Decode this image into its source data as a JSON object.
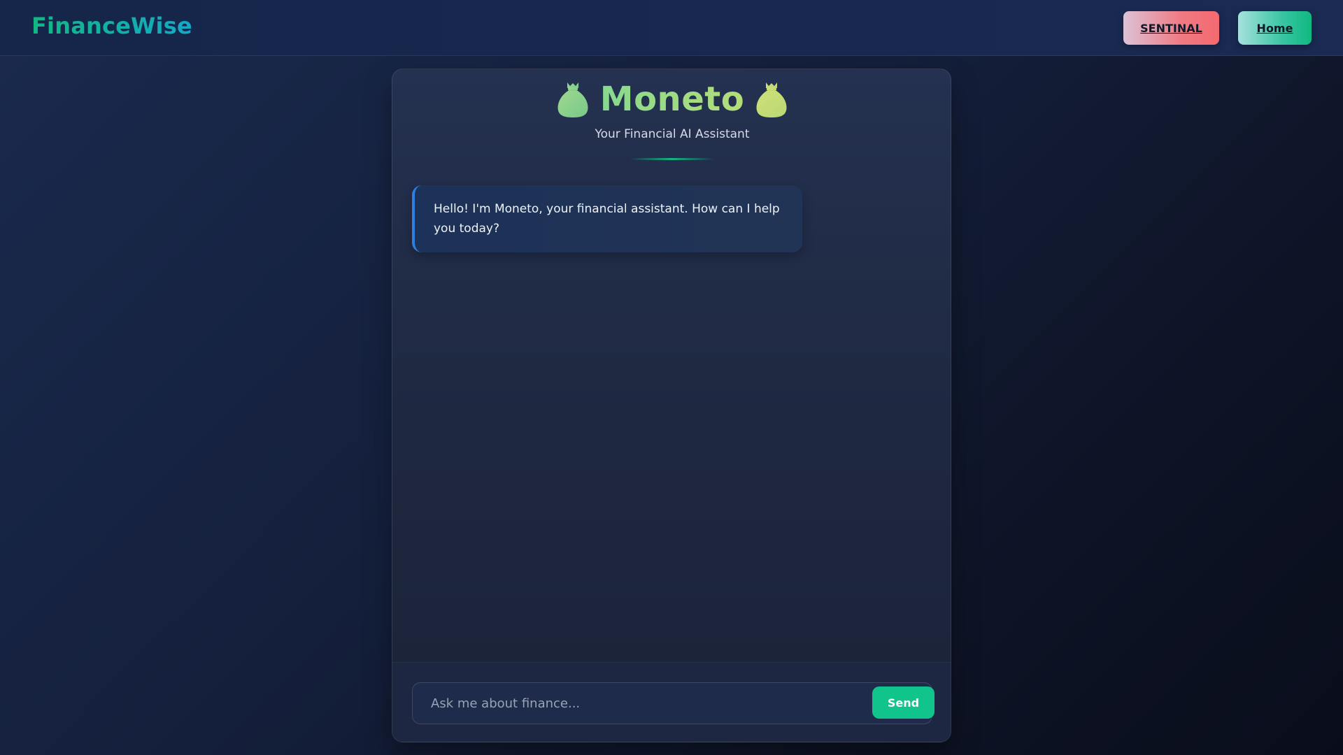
{
  "navbar": {
    "brand": "FinanceWise",
    "sentinal_label": "SENTINAL",
    "home_label": "Home"
  },
  "chat": {
    "title": "Moneto",
    "subtitle": "Your Financial AI Assistant",
    "title_icon": "money-bag-icon",
    "messages": [
      {
        "sender": "bot",
        "text": "Hello! I'm Moneto, your financial assistant. How can I help you today?"
      }
    ],
    "input_placeholder": "Ask me about finance...",
    "input_value": "",
    "send_label": "Send"
  },
  "colors": {
    "brand_accent": "#10b981",
    "sentinal_button": "#f07a84",
    "home_button": "#39c5a2",
    "bot_message_border": "#2f7fe0",
    "send_button": "#10c48b"
  }
}
